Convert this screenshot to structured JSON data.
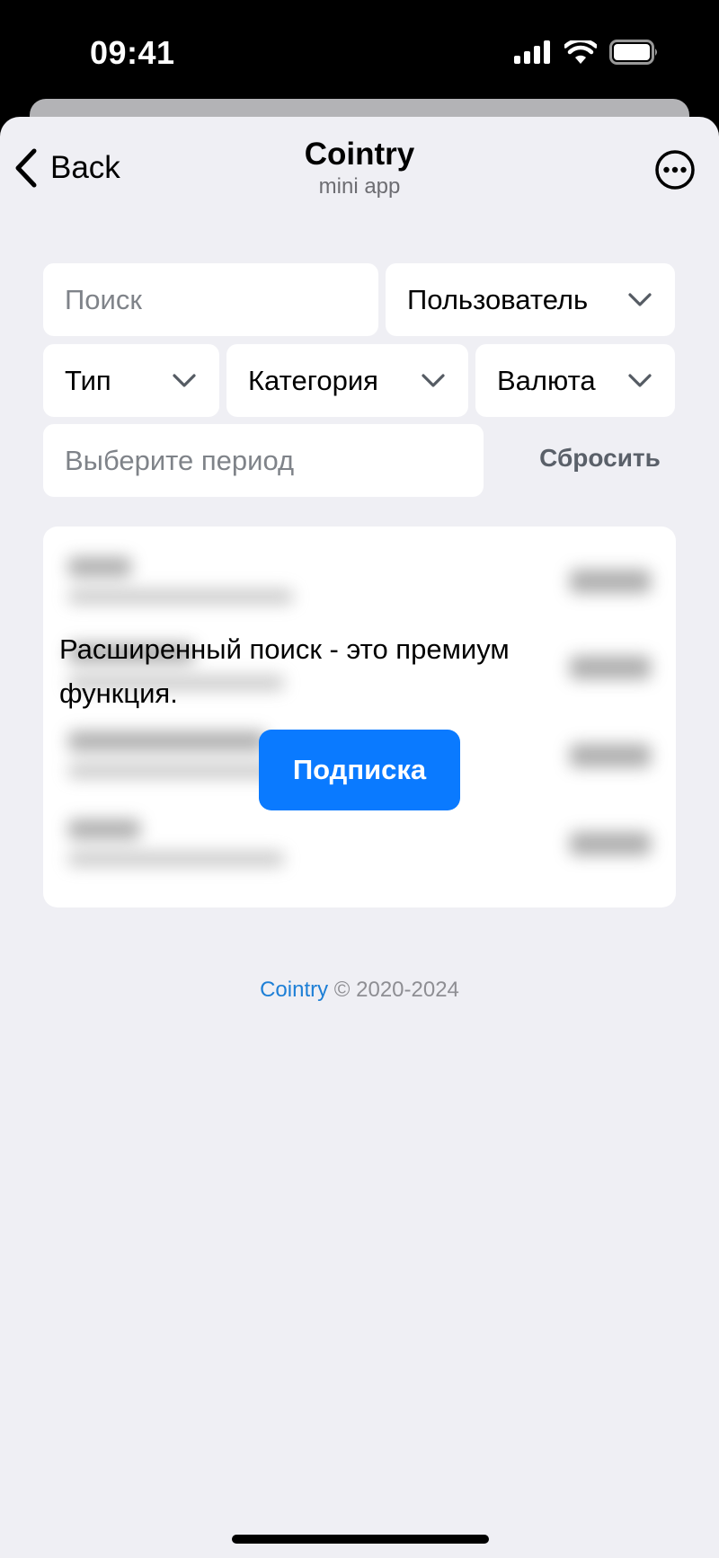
{
  "status_bar": {
    "time": "09:41"
  },
  "nav": {
    "back_label": "Back",
    "title": "Cointry",
    "subtitle": "mini app",
    "more_icon": "more-horizontal-circle-icon"
  },
  "filters": {
    "search_placeholder": "Поиск",
    "user_label": "Пользователь",
    "type_label": "Тип",
    "category_label": "Категория",
    "currency_label": "Валюта",
    "period_placeholder": "Выберите период",
    "reset_label": "Сбросить"
  },
  "premium": {
    "message": "Расширенный поиск - это премиум функция.",
    "subscribe_label": "Подписка"
  },
  "footer": {
    "brand": "Cointry",
    "copyright": "© 2020-2024"
  },
  "colors": {
    "accent": "#0a7aff",
    "link": "#1d7fd6",
    "background": "#efeff4"
  }
}
